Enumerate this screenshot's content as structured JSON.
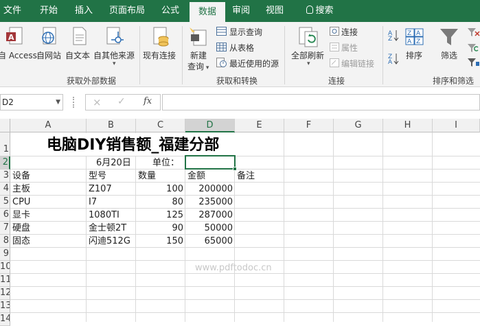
{
  "tabs": [
    "文件",
    "开始",
    "插入",
    "页面布局",
    "公式",
    "数据",
    "审阅",
    "视图",
    "搜索"
  ],
  "active_tab": "数据",
  "ribbon": {
    "get_external": {
      "buttons": [
        "自 Access",
        "自网站",
        "自文本",
        "自其他来源",
        "现有连接"
      ],
      "group_label": "获取外部数据"
    },
    "get_transform": {
      "new_query": [
        "新建",
        "查询"
      ],
      "small": [
        "显示查询",
        "从表格",
        "最近使用的源"
      ],
      "group_label": "获取和转换"
    },
    "connections": {
      "refresh_all": "全部刷新",
      "small": [
        "连接",
        "属性",
        "编辑链接"
      ],
      "group_label": "连接"
    },
    "sort_filter": {
      "sort": "排序",
      "filter": "筛选",
      "group_label": "排序和筛选"
    }
  },
  "namebox": "D2",
  "formula_icons": [
    "×",
    "✓",
    "fx"
  ],
  "formula_value": "",
  "columns": [
    "A",
    "B",
    "C",
    "D",
    "E",
    "F",
    "G",
    "H",
    "I"
  ],
  "rows": [
    "1",
    "2",
    "3",
    "4",
    "5",
    "6",
    "7",
    "8",
    "9",
    "10",
    "11",
    "12",
    "13",
    "14"
  ],
  "sheet": {
    "title": "电脑DIY销售额_福建分部",
    "date": "6月20日",
    "unit_label": "单位：",
    "headers": [
      "设备",
      "型号",
      "数量",
      "金额",
      "备注"
    ],
    "data": [
      [
        "主板",
        "Z107",
        "100",
        "200000"
      ],
      [
        "CPU",
        "I7",
        "80",
        "235000"
      ],
      [
        "显卡",
        "1080TI",
        "125",
        "287000"
      ],
      [
        "硬盘",
        "金士顿2T",
        "90",
        "50000"
      ],
      [
        "固态",
        "闪迪512G",
        "150",
        "65000"
      ]
    ]
  },
  "watermark": "www.pdftodoc.cn",
  "colors": {
    "excel_green": "#217346",
    "ribbon_bg": "#f3f3f3"
  }
}
